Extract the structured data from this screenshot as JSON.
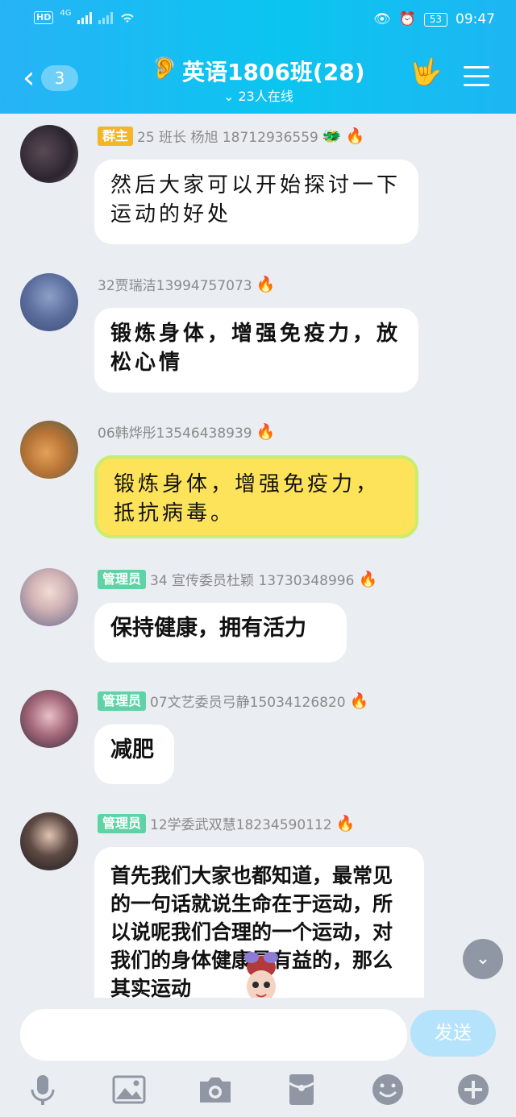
{
  "status": {
    "hd": "HD",
    "network": "4G",
    "battery": "53",
    "time": "09:47"
  },
  "header": {
    "back_badge": "3",
    "title": "英语1806班(28)",
    "online": "23人在线"
  },
  "messages": [
    {
      "tag": "群主",
      "sender": "25 班长   杨旭   18712936559",
      "text": "然后大家可以开始探讨一下运动的好处"
    },
    {
      "tag": "",
      "sender": "32贾瑞洁13994757073",
      "text": "锻炼身体，增强免疫力，放松心情"
    },
    {
      "tag": "",
      "sender": "06韩烨彤13546438939",
      "text": "锻炼身体，增强免疫力，抵抗病毒。"
    },
    {
      "tag": "管理员",
      "sender": "34 宣传委员杜颖 13730348996",
      "text": "保持健康，拥有活力"
    },
    {
      "tag": "管理员",
      "sender": "07文艺委员弓静15034126820",
      "text": "减肥"
    },
    {
      "tag": "管理员",
      "sender": "12学委武双慧18234590112",
      "text": "首先我们大家也都知道，最常见的一句话就说生命在于运动，所以说呢我们合理的一个运动，对我们的身体健康是有益的，那么其实运动"
    }
  ],
  "input": {
    "placeholder": "",
    "send_label": "发送"
  },
  "icons": [
    "mic-icon",
    "image-icon",
    "camera-icon",
    "red-packet-icon",
    "emoji-icon",
    "plus-icon"
  ]
}
